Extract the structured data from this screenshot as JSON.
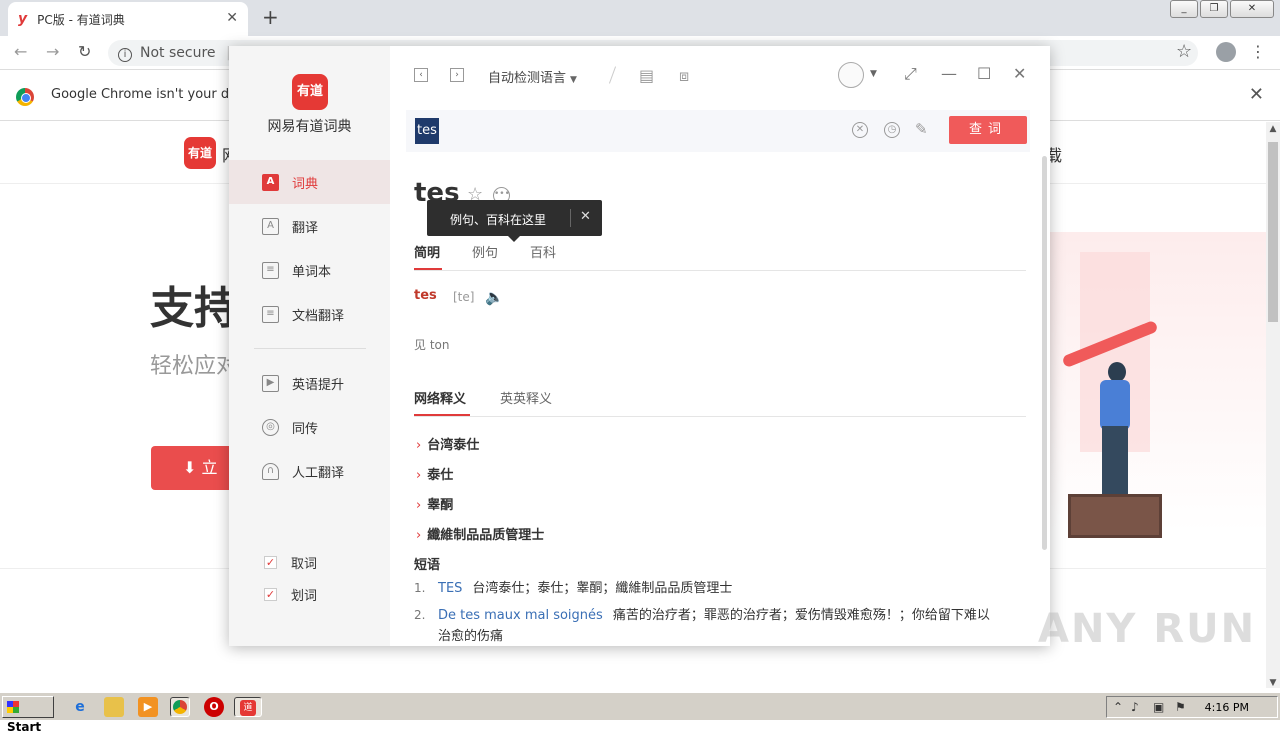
{
  "browser": {
    "tab_title": "PC版 - 有道词典",
    "tab_favicon": "y",
    "address_security": "Not secure",
    "address_partial": "c",
    "infobar_text": "Google Chrome isn't your default"
  },
  "page": {
    "header_logo": "有道",
    "header_logo_text": "网",
    "header_right": "载",
    "hero": "支持",
    "sub": "轻松应对",
    "download": "立"
  },
  "app": {
    "logo": "有道",
    "name": "网易有道词典",
    "nav": [
      {
        "label": "词典",
        "icon": "dictionary-icon",
        "glyph": "A"
      },
      {
        "label": "翻译",
        "icon": "translate-icon",
        "glyph": "A"
      },
      {
        "label": "单词本",
        "icon": "wordbook-icon",
        "glyph": "≡"
      },
      {
        "label": "文档翻译",
        "icon": "document-icon",
        "glyph": "≡"
      },
      {
        "label": "英语提升",
        "icon": "play-icon",
        "glyph": "▶"
      },
      {
        "label": "同传",
        "icon": "sync-icon",
        "glyph": "◎"
      },
      {
        "label": "人工翻译",
        "icon": "headset-icon",
        "glyph": "∩"
      }
    ],
    "checkboxes": [
      {
        "label": "取词",
        "checked": true
      },
      {
        "label": "划词",
        "checked": true
      }
    ],
    "language_select": "自动检测语言",
    "query": "tes",
    "query_button": "查词",
    "word": "tes",
    "tooltip": "例句、百科在这里",
    "detail_tabs": [
      "简明",
      "例句",
      "百科"
    ],
    "basic": {
      "word": "tes",
      "phonetic": "[te]"
    },
    "see_also": "见 ton",
    "sub_tabs": [
      "网络释义",
      "英英释义"
    ],
    "web_defs": [
      "台湾泰仕",
      "泰仕",
      "睾酮",
      "纖維制品品质管理士"
    ],
    "phrases_title": "短语",
    "phrases": [
      {
        "num": "1.",
        "en": "TES",
        "zh": "台湾泰仕；泰仕；睾酮；纖維制品品质管理士",
        "cont": ""
      },
      {
        "num": "2.",
        "en": "De tes maux mal soignés",
        "zh": "痛苦的治疗者；罪恶的治疗者；爱伤情毁难愈殇！；你给留下难以",
        "cont": "治愈的伤痛"
      }
    ]
  },
  "taskbar": {
    "start": "Start",
    "clock": "4:16 PM"
  },
  "watermark": "ANY RUN",
  "colors": {
    "accent": "#e03a3a",
    "query_button": "#f05a5a",
    "link": "#3a6fb5"
  }
}
